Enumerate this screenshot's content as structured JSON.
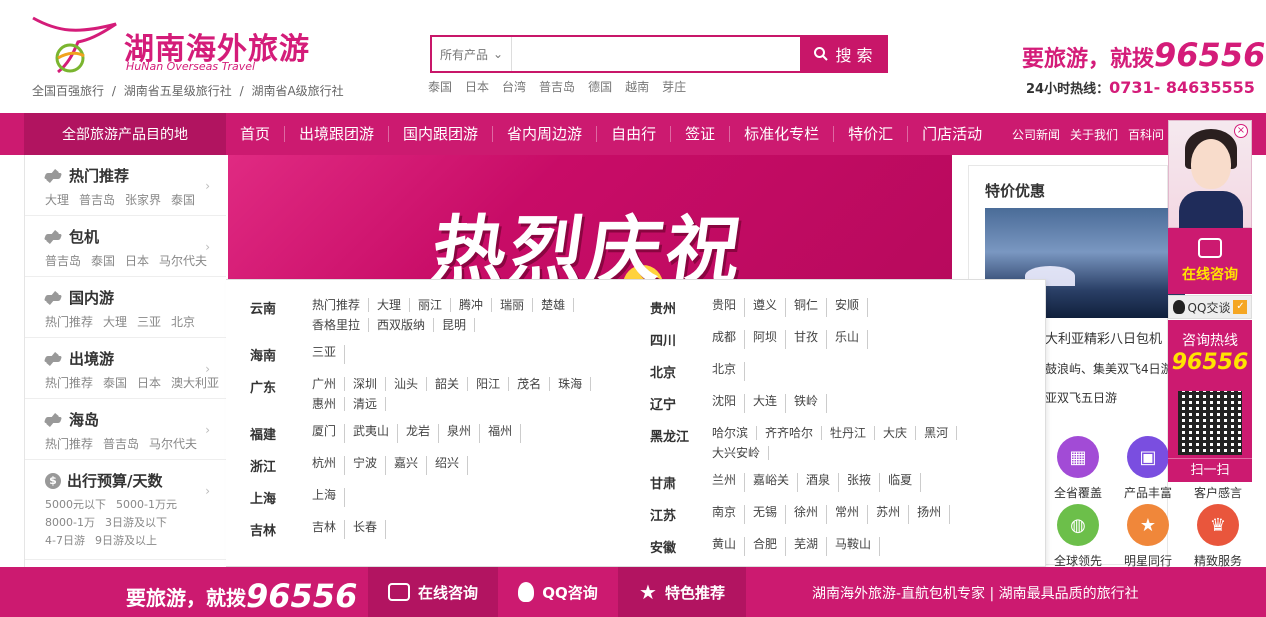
{
  "brand": {
    "title": "湖南海外旅游",
    "subtitle": "HuNan Overseas Travel",
    "tagline": [
      "全国百强旅行",
      "/",
      "湖南省五星级旅行社",
      "/",
      "湖南省A级旅行社"
    ]
  },
  "search": {
    "category": "所有产品",
    "placeholder": "",
    "button": "搜 索",
    "hotwords": [
      "泰国",
      "日本",
      "台湾",
      "普吉岛",
      "德国",
      "越南",
      "芽庄"
    ]
  },
  "hotline": {
    "slogan": "要旅游，就拨",
    "number": "96556",
    "label": "24小时热线：",
    "phone": "0731- 84635555"
  },
  "nav": {
    "all_products": "全部旅游产品目的地",
    "items": [
      "首页",
      "出境跟团游",
      "国内跟团游",
      "省内周边游",
      "自由行",
      "签证",
      "标准化专栏",
      "特价汇",
      "门店活动"
    ],
    "small": [
      "公司新闻",
      "关于我们",
      "百科问"
    ]
  },
  "leftmenu": [
    {
      "title": "热门推荐",
      "subs": [
        "大理",
        "普吉岛",
        "张家界",
        "泰国"
      ]
    },
    {
      "title": "包机",
      "subs": [
        "普吉岛",
        "泰国",
        "日本",
        "马尔代夫"
      ]
    },
    {
      "title": "国内游",
      "subs": [
        "热门推荐",
        "大理",
        "三亚",
        "北京"
      ]
    },
    {
      "title": "出境游",
      "subs": [
        "热门推荐",
        "泰国",
        "日本",
        "澳大利亚"
      ]
    },
    {
      "title": "海岛",
      "subs": [
        "热门推荐",
        "普吉岛",
        "马尔代夫"
      ]
    },
    {
      "title": "出行预算/天数",
      "subs": [
        "5000元以下",
        "5000-1万元",
        "8000-1万",
        "3日游及以下",
        "4-7日游",
        "9日游及以上"
      ]
    }
  ],
  "banner": {
    "headline": "热烈庆祝"
  },
  "panel": {
    "left": [
      {
        "province": "云南",
        "cities": [
          "热门推荐",
          "大理",
          "丽江",
          "腾冲",
          "瑞丽",
          "楚雄",
          "香格里拉",
          "西双版纳",
          "昆明"
        ]
      },
      {
        "province": "海南",
        "cities": [
          "三亚"
        ]
      },
      {
        "province": "广东",
        "cities": [
          "广州",
          "深圳",
          "汕头",
          "韶关",
          "阳江",
          "茂名",
          "珠海",
          "惠州",
          "清远"
        ]
      },
      {
        "province": "福建",
        "cities": [
          "厦门",
          "武夷山",
          "龙岩",
          "泉州",
          "福州"
        ]
      },
      {
        "province": "浙江",
        "cities": [
          "杭州",
          "宁波",
          "嘉兴",
          "绍兴"
        ]
      },
      {
        "province": "上海",
        "cities": [
          "上海"
        ]
      },
      {
        "province": "吉林",
        "cities": [
          "吉林",
          "长春"
        ]
      }
    ],
    "right": [
      {
        "province": "贵州",
        "cities": [
          "贵阳",
          "遵义",
          "铜仁",
          "安顺"
        ]
      },
      {
        "province": "四川",
        "cities": [
          "成都",
          "阿坝",
          "甘孜",
          "乐山"
        ]
      },
      {
        "province": "北京",
        "cities": [
          "北京"
        ]
      },
      {
        "province": "辽宁",
        "cities": [
          "沈阳",
          "大连",
          "铁岭"
        ]
      },
      {
        "province": "黑龙江",
        "cities": [
          "哈尔滨",
          "齐齐哈尔",
          "牡丹江",
          "大庆",
          "黑河",
          "大兴安岭"
        ]
      },
      {
        "province": "甘肃",
        "cities": [
          "兰州",
          "嘉峪关",
          "酒泉",
          "张掖",
          "临夏"
        ]
      },
      {
        "province": "江苏",
        "cities": [
          "南京",
          "无锡",
          "徐州",
          "常州",
          "苏州",
          "扬州"
        ]
      },
      {
        "province": "安徽",
        "cities": [
          "黄山",
          "合肥",
          "芜湖",
          "马鞍山"
        ]
      }
    ]
  },
  "specials": {
    "title": "特价优惠",
    "list": [
      "大利亚精彩八日包机",
      "鼓浪屿、集美双飞4日游",
      "亚双飞五日游"
    ],
    "icons": [
      {
        "label": "全省覆盖",
        "color": "#a24bd6",
        "icon": "map-icon"
      },
      {
        "label": "产品丰富",
        "color": "#7a4ee0",
        "icon": "bag-icon"
      },
      {
        "label": "客户感言",
        "color": "#cc1a70",
        "icon": "comment-icon"
      },
      {
        "label": "全球领先",
        "color": "#6cbf4a",
        "icon": "globe-icon"
      },
      {
        "label": "明星同行",
        "color": "#f0873a",
        "icon": "star-icon"
      },
      {
        "label": "精致服务",
        "color": "#e9563c",
        "icon": "crown-icon"
      }
    ]
  },
  "float": {
    "close": "×",
    "chat": "在线咨询",
    "qq": "QQ交谈",
    "hot_label": "咨询热线",
    "hot_number": "96556",
    "scan": "扫一扫"
  },
  "footer": {
    "slogan": "要旅游，就拨",
    "number": "96556",
    "b1": "在线咨询",
    "b2": "QQ咨询",
    "b3": "特色推荐",
    "right": "湖南海外旅游-直航包机专家 | 湖南最具品质的旅行社"
  },
  "colors": {
    "brand": "#cc1a70",
    "accent": "#ffe400"
  }
}
